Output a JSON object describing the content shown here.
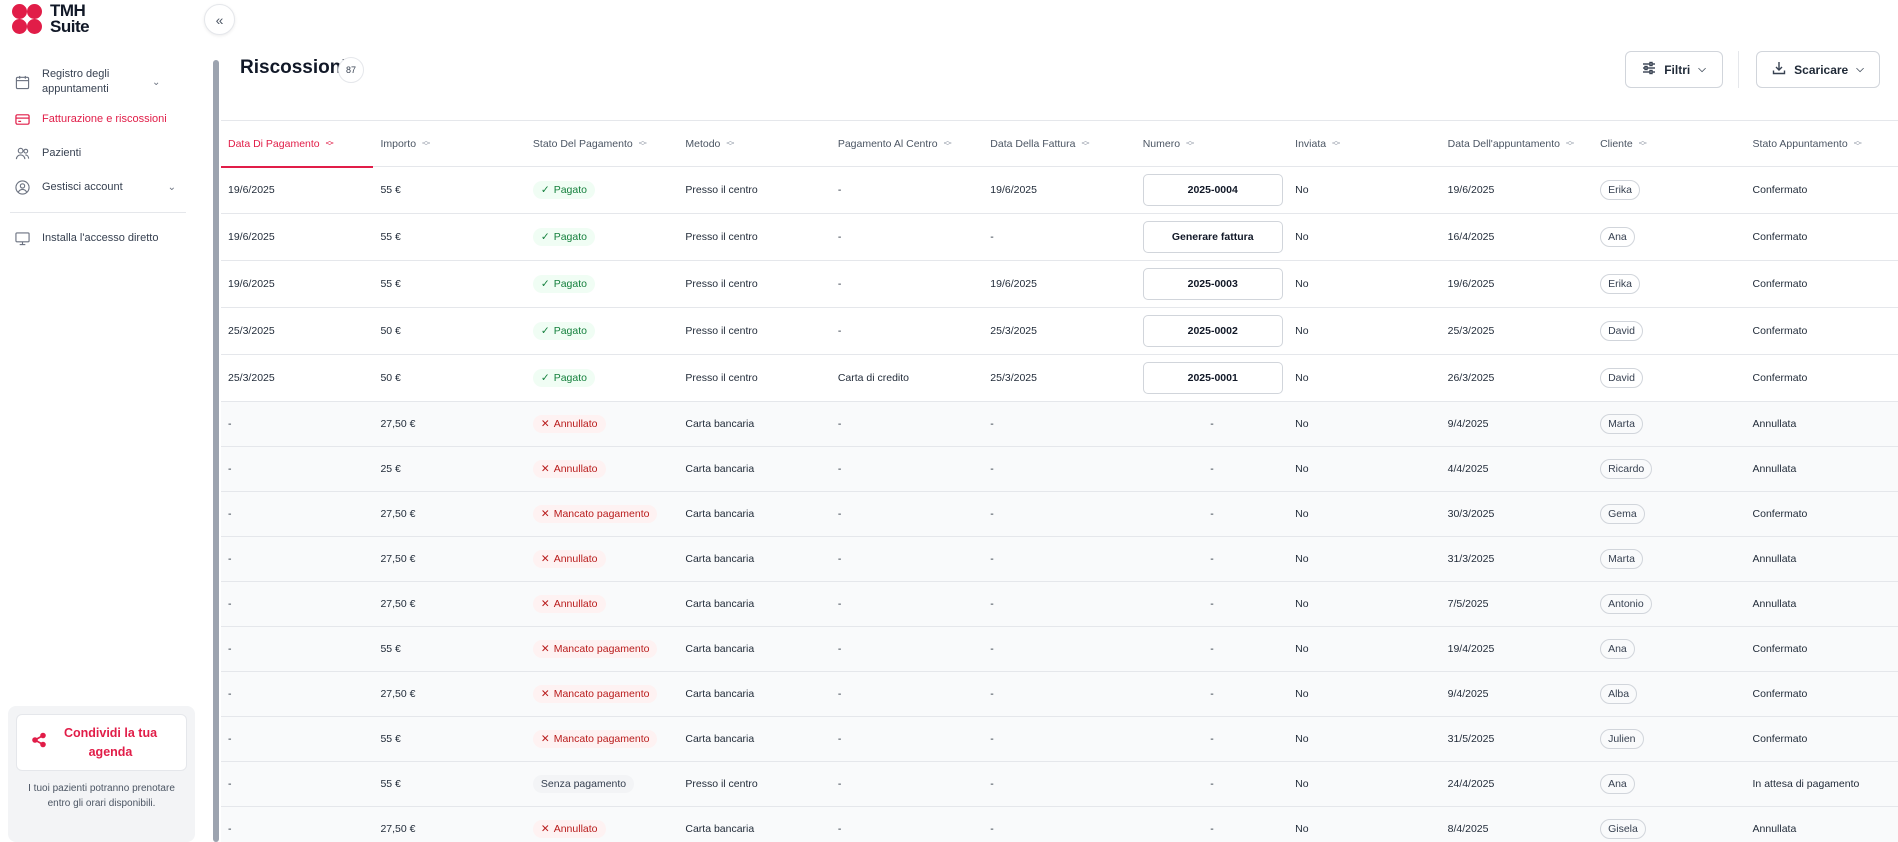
{
  "brand": {
    "line1": "TMH",
    "line2": "Suite",
    "color": "#e11d48"
  },
  "sidebar": {
    "items": [
      {
        "label": "Registro degli appuntamenti",
        "icon": "calendar-icon",
        "has_chevron": true
      },
      {
        "label": "Fatturazione e riscossioni",
        "icon": "credit-card-icon",
        "active": true
      },
      {
        "label": "Pazienti",
        "icon": "users-icon"
      },
      {
        "label": "Gestisci account",
        "icon": "user-circle-icon",
        "has_chevron": true
      },
      {
        "label": "Installa l'accesso diretto",
        "icon": "monitor-icon"
      }
    ],
    "share": {
      "title": "Condividi la tua agenda",
      "description": "I tuoi pazienti potranno prenotare entro gli orari disponibili."
    }
  },
  "header": {
    "title": "Riscossioni",
    "count": "87",
    "filter_label": "Filtri",
    "download_label": "Scaricare"
  },
  "table": {
    "columns": [
      "Data Di Pagamento",
      "Importo",
      "Stato Del Pagamento",
      "Metodo",
      "Pagamento Al Centro",
      "Data Della Fattura",
      "Numero",
      "Inviata",
      "Data Dell'appuntamento",
      "Cliente",
      "Stato Appuntamento"
    ],
    "rows": [
      {
        "paid_on": "19/6/2025",
        "amount": "55 €",
        "status": "Pagato",
        "kind": "ok",
        "method": "Presso il centro",
        "center": "-",
        "invoice_date": "19/6/2025",
        "number": "2025-0004",
        "number_button": true,
        "sent": "No",
        "appt_date": "19/6/2025",
        "client": "Erika",
        "appt_status": "Confermato"
      },
      {
        "paid_on": "19/6/2025",
        "amount": "55 €",
        "status": "Pagato",
        "kind": "ok",
        "method": "Presso il centro",
        "center": "-",
        "invoice_date": "-",
        "number": "Generare fattura",
        "number_button": true,
        "sent": "No",
        "appt_date": "16/4/2025",
        "client": "Ana",
        "appt_status": "Confermato"
      },
      {
        "paid_on": "19/6/2025",
        "amount": "55 €",
        "status": "Pagato",
        "kind": "ok",
        "method": "Presso il centro",
        "center": "-",
        "invoice_date": "19/6/2025",
        "number": "2025-0003",
        "number_button": true,
        "sent": "No",
        "appt_date": "19/6/2025",
        "client": "Erika",
        "appt_status": "Confermato"
      },
      {
        "paid_on": "25/3/2025",
        "amount": "50 €",
        "status": "Pagato",
        "kind": "ok",
        "method": "Presso il centro",
        "center": "-",
        "invoice_date": "25/3/2025",
        "number": "2025-0002",
        "number_button": true,
        "sent": "No",
        "appt_date": "25/3/2025",
        "client": "David",
        "appt_status": "Confermato"
      },
      {
        "paid_on": "25/3/2025",
        "amount": "50 €",
        "status": "Pagato",
        "kind": "ok",
        "method": "Presso il centro",
        "center": "Carta di credito",
        "invoice_date": "25/3/2025",
        "number": "2025-0001",
        "number_button": true,
        "sent": "No",
        "appt_date": "26/3/2025",
        "client": "David",
        "appt_status": "Confermato"
      },
      {
        "paid_on": "-",
        "amount": "27,50 €",
        "status": "Annullato",
        "kind": "bad",
        "method": "Carta bancaria",
        "center": "-",
        "invoice_date": "-",
        "number": "-",
        "number_button": false,
        "sent": "No",
        "appt_date": "9/4/2025",
        "client": "Marta",
        "appt_status": "Annullata"
      },
      {
        "paid_on": "-",
        "amount": "25 €",
        "status": "Annullato",
        "kind": "bad",
        "method": "Carta bancaria",
        "center": "-",
        "invoice_date": "-",
        "number": "-",
        "number_button": false,
        "sent": "No",
        "appt_date": "4/4/2025",
        "client": "Ricardo",
        "appt_status": "Annullata"
      },
      {
        "paid_on": "-",
        "amount": "27,50 €",
        "status": "Mancato pagamento",
        "kind": "bad",
        "method": "Carta bancaria",
        "center": "-",
        "invoice_date": "-",
        "number": "-",
        "number_button": false,
        "sent": "No",
        "appt_date": "30/3/2025",
        "client": "Gema",
        "appt_status": "Confermato"
      },
      {
        "paid_on": "-",
        "amount": "27,50 €",
        "status": "Annullato",
        "kind": "bad",
        "method": "Carta bancaria",
        "center": "-",
        "invoice_date": "-",
        "number": "-",
        "number_button": false,
        "sent": "No",
        "appt_date": "31/3/2025",
        "client": "Marta",
        "appt_status": "Annullata"
      },
      {
        "paid_on": "-",
        "amount": "27,50 €",
        "status": "Annullato",
        "kind": "bad",
        "method": "Carta bancaria",
        "center": "-",
        "invoice_date": "-",
        "number": "-",
        "number_button": false,
        "sent": "No",
        "appt_date": "7/5/2025",
        "client": "Antonio",
        "appt_status": "Annullata"
      },
      {
        "paid_on": "-",
        "amount": "55 €",
        "status": "Mancato pagamento",
        "kind": "bad",
        "method": "Carta bancaria",
        "center": "-",
        "invoice_date": "-",
        "number": "-",
        "number_button": false,
        "sent": "No",
        "appt_date": "19/4/2025",
        "client": "Ana",
        "appt_status": "Confermato"
      },
      {
        "paid_on": "-",
        "amount": "27,50 €",
        "status": "Mancato pagamento",
        "kind": "bad",
        "method": "Carta bancaria",
        "center": "-",
        "invoice_date": "-",
        "number": "-",
        "number_button": false,
        "sent": "No",
        "appt_date": "9/4/2025",
        "client": "Alba",
        "appt_status": "Confermato"
      },
      {
        "paid_on": "-",
        "amount": "55 €",
        "status": "Mancato pagamento",
        "kind": "bad",
        "method": "Carta bancaria",
        "center": "-",
        "invoice_date": "-",
        "number": "-",
        "number_button": false,
        "sent": "No",
        "appt_date": "31/5/2025",
        "client": "Julien",
        "appt_status": "Confermato"
      },
      {
        "paid_on": "-",
        "amount": "55 €",
        "status": "Senza pagamento",
        "kind": "none",
        "method": "Presso il centro",
        "center": "-",
        "invoice_date": "-",
        "number": "-",
        "number_button": false,
        "sent": "No",
        "appt_date": "24/4/2025",
        "client": "Ana",
        "appt_status": "In attesa di pagamento"
      },
      {
        "paid_on": "-",
        "amount": "27,50 €",
        "status": "Annullato",
        "kind": "bad",
        "method": "Carta bancaria",
        "center": "-",
        "invoice_date": "-",
        "number": "-",
        "number_button": false,
        "sent": "No",
        "appt_date": "8/4/2025",
        "client": "Gisela",
        "appt_status": "Annullata"
      }
    ]
  }
}
